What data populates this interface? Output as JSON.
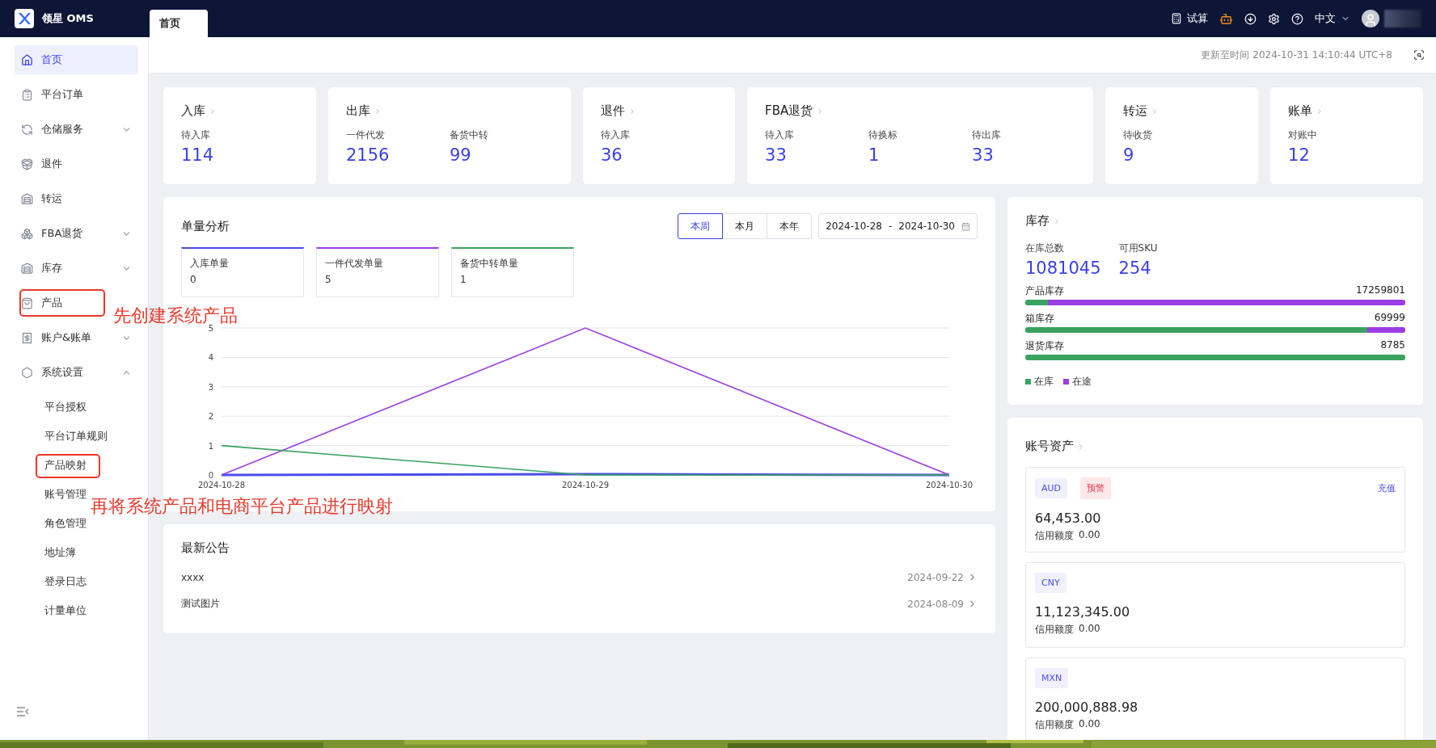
{
  "app": {
    "logo_text": "领星 OMS"
  },
  "tabs": [
    {
      "label": "首页",
      "selected": true
    }
  ],
  "toolbar": {
    "calc_label": "试算",
    "language": "中文"
  },
  "update_time": "更新至时间 2024-10-31 14:10:44 UTC+8",
  "sidebar": {
    "items": [
      {
        "label": "首页",
        "selected": true,
        "outlined": false
      },
      {
        "label": "平台订单",
        "selected": false,
        "outlined": false
      },
      {
        "label": "仓储服务",
        "selected": false,
        "outlined": false,
        "expanded": false
      },
      {
        "label": "退件",
        "selected": false,
        "outlined": false
      },
      {
        "label": "转运",
        "selected": false,
        "outlined": false
      },
      {
        "label": "FBA退货",
        "selected": false,
        "outlined": false,
        "expanded": false
      },
      {
        "label": "库存",
        "selected": false,
        "outlined": false,
        "expanded": false
      },
      {
        "label": "产品",
        "selected": false,
        "outlined": true
      },
      {
        "label": "账户&账单",
        "selected": false,
        "outlined": false,
        "expanded": false
      },
      {
        "label": "系统设置",
        "selected": false,
        "outlined": false,
        "expanded": true,
        "children": [
          {
            "label": "平台授权",
            "selected": false,
            "outlined": false
          },
          {
            "label": "平台订单规则",
            "selected": false,
            "outlined": false
          },
          {
            "label": "产品映射",
            "selected": false,
            "outlined": true
          },
          {
            "label": "账号管理",
            "selected": false,
            "outlined": false
          },
          {
            "label": "角色管理",
            "selected": false,
            "outlined": false
          },
          {
            "label": "地址簿",
            "selected": false,
            "outlined": false
          },
          {
            "label": "登录日志",
            "selected": false,
            "outlined": false
          },
          {
            "label": "计量单位",
            "selected": false,
            "outlined": false
          }
        ]
      }
    ]
  },
  "stats": [
    {
      "title": "入库",
      "metrics": [
        {
          "label": "待入库",
          "value": "114"
        }
      ]
    },
    {
      "title": "出库",
      "metrics": [
        {
          "label": "一件代发",
          "value": "2156"
        },
        {
          "label": "备货中转",
          "value": "99"
        }
      ]
    },
    {
      "title": "退件",
      "metrics": [
        {
          "label": "待入库",
          "value": "36"
        }
      ]
    },
    {
      "title": "FBA退货",
      "metrics": [
        {
          "label": "待入库",
          "value": "33"
        },
        {
          "label": "待换标",
          "value": "1"
        },
        {
          "label": "待出库",
          "value": "33"
        }
      ]
    },
    {
      "title": "转运",
      "metrics": [
        {
          "label": "待收货",
          "value": "9"
        }
      ]
    },
    {
      "title": "账单",
      "metrics": [
        {
          "label": "对账中",
          "value": "12"
        }
      ]
    }
  ],
  "analysis": {
    "title": "单量分析",
    "ranges": [
      {
        "label": "本周",
        "selected": true
      },
      {
        "label": "本月",
        "selected": false
      },
      {
        "label": "本年",
        "selected": false
      }
    ],
    "date_range": {
      "start": "2024-10-28",
      "separator": "-",
      "end": "2024-10-30"
    },
    "summary": [
      {
        "value": "0"
      },
      {
        "value": "5"
      },
      {
        "value": "1"
      }
    ],
    "chart_data": {
      "type": "line",
      "grid": true,
      "categories": [
        "2024-10-28",
        "2024-10-29",
        "2024-10-30"
      ],
      "ylim": [
        0,
        5
      ],
      "yticks": [
        0,
        1,
        2,
        3,
        4,
        5
      ],
      "series": [
        {
          "name": "入库单量",
          "color": "#4b4ee8",
          "values": [
            0,
            0,
            0
          ]
        },
        {
          "name": "一件代发单量",
          "color": "#9b3de6",
          "values": [
            0,
            5,
            0
          ]
        },
        {
          "name": "备货中转单量",
          "color": "#3aa35f",
          "values": [
            1,
            0,
            0
          ]
        }
      ]
    }
  },
  "notices": {
    "title": "最新公告",
    "items": [
      {
        "title": "xxxx",
        "date": "2024-09-22"
      },
      {
        "title": "测试图片",
        "date": "2024-08-09"
      }
    ]
  },
  "inventory": {
    "title": "库存",
    "totals": [
      {
        "label": "在库总数",
        "value": "1081045"
      },
      {
        "label": "可用SKU",
        "value": "254"
      }
    ],
    "bars": [
      {
        "label": "产品库存",
        "value": "17259801",
        "level": 0.06
      },
      {
        "label": "箱库存",
        "value": "69999",
        "level": 0.9
      },
      {
        "label": "退货库存",
        "value": "8785",
        "level": 1
      }
    ],
    "legend": [
      {
        "label": "在库",
        "color": "#3aa35f"
      },
      {
        "label": "在途",
        "color": "#9b3de6"
      }
    ]
  },
  "accounts": {
    "title": "账号资产",
    "items": [
      {
        "currency": "AUD",
        "warning": "预警",
        "action": "充值",
        "balance": "64,453.00",
        "credit_label": "信用额度",
        "credit": "0.00"
      },
      {
        "currency": "CNY",
        "balance": "11,123,345.00",
        "credit_label": "信用额度",
        "credit": "0.00"
      },
      {
        "currency": "MXN",
        "balance": "200,000,888.98",
        "credit_label": "信用额度",
        "credit": "0.00"
      }
    ]
  },
  "annotations": [
    {
      "text": "先创建系统产品"
    },
    {
      "text": "再将系统产品和电商平台产品进行映射"
    }
  ]
}
